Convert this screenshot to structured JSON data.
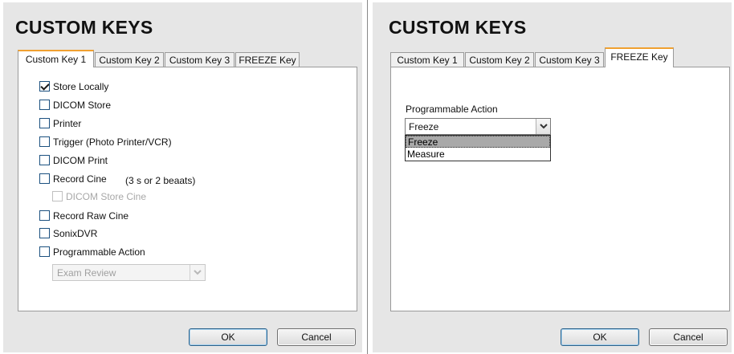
{
  "left": {
    "title": "CUSTOM KEYS",
    "tabs": [
      "Custom Key 1",
      "Custom Key 2",
      "Custom Key 3",
      "FREEZE Key"
    ],
    "active_tab": "Custom Key 1",
    "options": [
      {
        "label": "Store Locally",
        "checked": true,
        "enabled": true
      },
      {
        "label": "DICOM Store",
        "checked": false,
        "enabled": true
      },
      {
        "label": "Printer",
        "checked": false,
        "enabled": true
      },
      {
        "label": "Trigger (Photo Printer/VCR)",
        "checked": false,
        "enabled": true
      },
      {
        "label": "DICOM Print",
        "checked": false,
        "enabled": true
      },
      {
        "label": "Record Cine",
        "checked": false,
        "enabled": true
      },
      {
        "label": "DICOM Store Cine",
        "checked": false,
        "enabled": false
      },
      {
        "label": "Record Raw Cine",
        "checked": false,
        "enabled": true
      },
      {
        "label": "SonixDVR",
        "checked": false,
        "enabled": true
      },
      {
        "label": "Programmable Action",
        "checked": false,
        "enabled": true
      }
    ],
    "record_cine_note": "(3 s or 2 beaats)",
    "programmable_select": {
      "value": "Exam Review",
      "enabled": false
    },
    "ok_label": "OK",
    "cancel_label": "Cancel"
  },
  "right": {
    "title": "CUSTOM KEYS",
    "tabs": [
      "Custom Key 1",
      "Custom Key 2",
      "Custom Key 3",
      "FREEZE Key"
    ],
    "active_tab": "FREEZE Key",
    "programmable_label": "Programmable Action",
    "select": {
      "value": "Freeze",
      "expanded": true
    },
    "dropdown_options": [
      "Freeze",
      "Measure"
    ],
    "highlighted_option": "Freeze",
    "ok_label": "OK",
    "cancel_label": "Cancel"
  },
  "colors": {
    "active_tab_accent": "#f0a030",
    "dialog_bg": "#e6e6e6",
    "checkbox_border": "#1c5180"
  }
}
